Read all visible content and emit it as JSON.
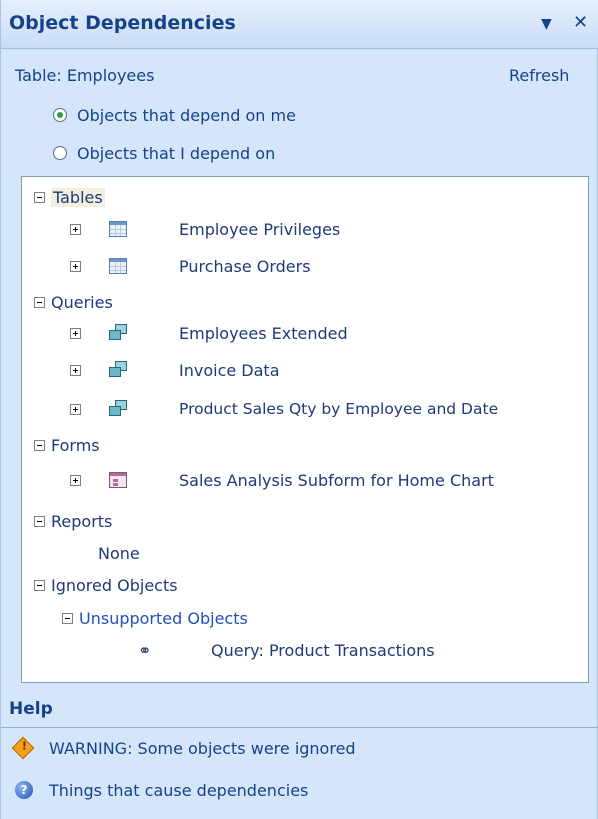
{
  "pane": {
    "title": "Object Dependencies",
    "dropdown_glyph": "▼",
    "close_glyph": "✕"
  },
  "header": {
    "object_label": "Table: Employees",
    "refresh_label": "Refresh"
  },
  "view_options": [
    {
      "label": "Objects that depend on me",
      "checked": true
    },
    {
      "label": "Objects that I depend on",
      "checked": false
    }
  ],
  "tree": {
    "groups": {
      "tables": {
        "label": "Tables",
        "items": [
          {
            "label": "Employee Privileges",
            "icon": "table-icon"
          },
          {
            "label": "Purchase Orders",
            "icon": "table-icon"
          }
        ]
      },
      "queries": {
        "label": "Queries",
        "items": [
          {
            "label": "Employees Extended",
            "icon": "query-icon"
          },
          {
            "label": "Invoice Data",
            "icon": "query-icon"
          },
          {
            "label": "Product Sales Qty by Employee and Date",
            "icon": "query-icon"
          }
        ]
      },
      "forms": {
        "label": "Forms",
        "items": [
          {
            "label": "Sales Analysis Subform for Home Chart",
            "icon": "form-icon"
          }
        ]
      },
      "reports": {
        "label": "Reports",
        "none_label": "None"
      },
      "ignored": {
        "label": "Ignored Objects",
        "unsupported_label": "Unsupported Objects",
        "items": [
          {
            "label": "Query: Product Transactions",
            "icon": "link-icon"
          }
        ]
      }
    }
  },
  "help": {
    "heading": "Help",
    "items": [
      {
        "label": "WARNING: Some objects were ignored",
        "icon": "warning-icon"
      },
      {
        "label": "Things that cause dependencies",
        "icon": "help-icon"
      }
    ]
  },
  "colors": {
    "pane_background": "#d6e6fa",
    "title_text": "#15428b",
    "tree_background": "#ffffff",
    "radio_checked": "#2e9e3a"
  }
}
